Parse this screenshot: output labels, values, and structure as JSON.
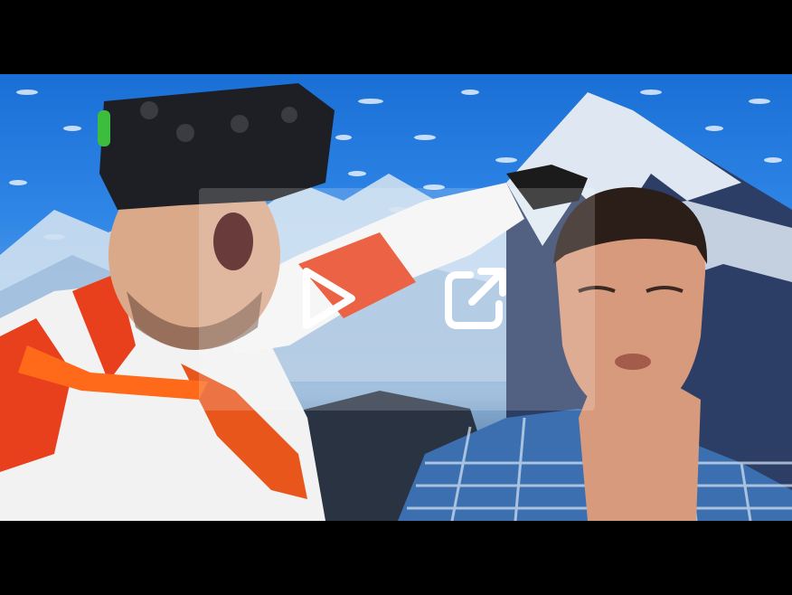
{
  "player": {
    "play_icon": "play-icon",
    "share_icon": "share-external-icon",
    "overlay_color": "#ffffff"
  },
  "thumbnail": {
    "description_colors": {
      "sky": "#2f86e6",
      "snow": "#e9f1fa",
      "jacket_red": "#e8401c",
      "shirt_blue": "#3b6fb0"
    }
  }
}
